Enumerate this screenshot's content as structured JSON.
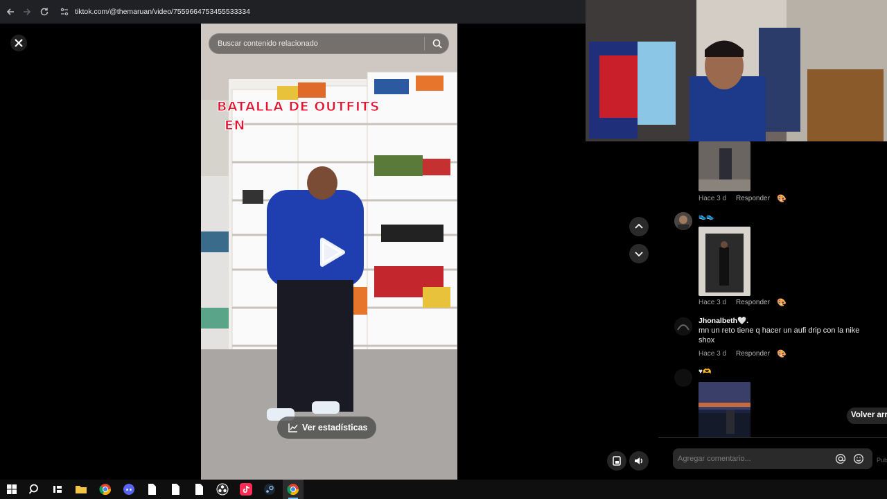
{
  "browser": {
    "url": "tiktok.com/@themaruan/video/7559664753455533334"
  },
  "video": {
    "search_placeholder": "Buscar contenido relacionado",
    "overlay_line1": "BATALLA DE OUTFITS",
    "overlay_line2": "EN",
    "stats_label": "Ver estadísticas"
  },
  "comments": {
    "items": [
      {
        "time": "Hace 3 d",
        "reply": "Responder"
      },
      {
        "text": "👟👟",
        "time": "Hace 3 d",
        "reply": "Responder"
      },
      {
        "user": "Jhonalbeth🤍.",
        "text": "mn un reto tiene q hacer un aufi drip con la nike shox",
        "time": "Hace 3 d",
        "reply": "Responder"
      },
      {
        "text": "♥🫶"
      }
    ],
    "back_to_top": "Volver arri",
    "input_placeholder": "Agregar comentario...",
    "publish": "Pub"
  },
  "colors": {
    "overlay_red": "#e8112d",
    "background": "#000000"
  },
  "icons": [
    "back-arrow-icon",
    "forward-arrow-icon",
    "reload-icon",
    "site-info-icon",
    "close-icon",
    "search-icon",
    "play-icon",
    "chart-icon",
    "chevron-up-icon",
    "chevron-down-icon",
    "mention-icon",
    "emoji-icon",
    "windows-icon",
    "search-taskbar-icon",
    "chrome-icon",
    "discord-icon",
    "file-icon",
    "tiktok-icon",
    "steam-icon"
  ]
}
